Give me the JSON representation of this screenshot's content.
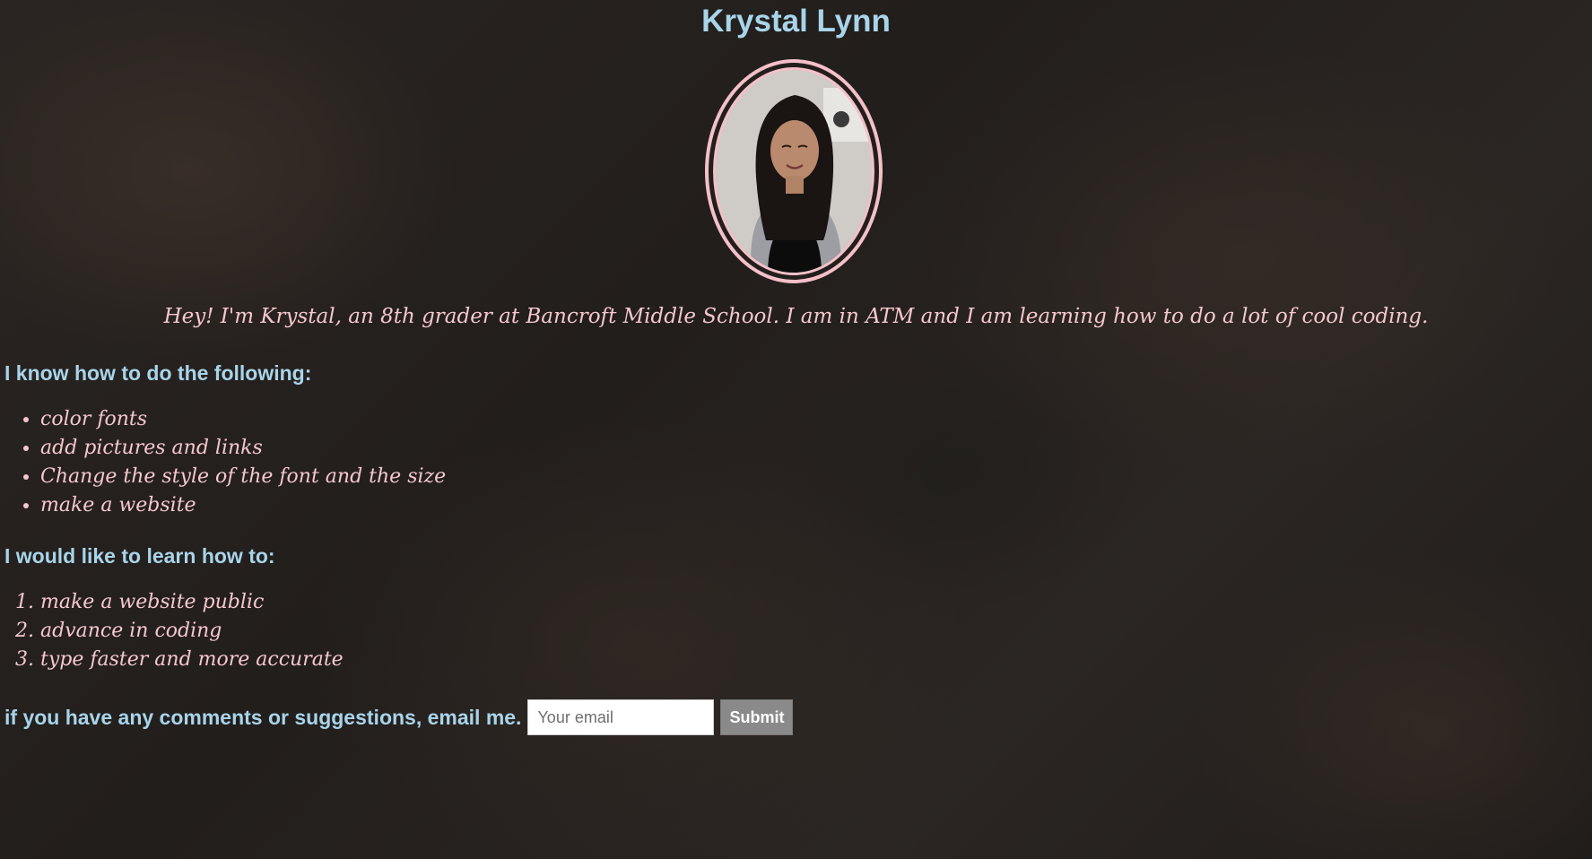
{
  "header": {
    "name": "Krystal Lynn"
  },
  "intro": {
    "text": "Hey! I'm Krystal, an 8th grader at Bancroft Middle School. I am in ATM and I am learning how to do a lot of cool coding."
  },
  "skills": {
    "heading": "I know how to do the following:",
    "items": [
      "color fonts",
      "add pictures and links",
      "Change the style of the font and the size",
      "make a website"
    ]
  },
  "goals": {
    "heading": "I would like to learn how to:",
    "items": [
      "make a website public",
      "advance in coding",
      "type faster and more accurate"
    ]
  },
  "contact": {
    "label": "if you have any comments or suggestions, email me.",
    "email_placeholder": "Your email",
    "submit_label": "Submit"
  },
  "colors": {
    "heading": "#a8d4ea",
    "body_text": "#f6c7cd",
    "frame": "#f4c0c8",
    "button": "#8a8a8a"
  }
}
